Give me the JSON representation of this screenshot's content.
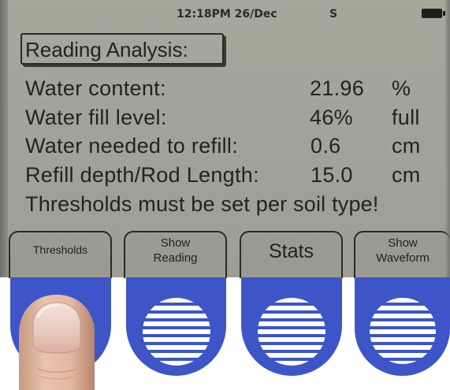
{
  "status_bar": {
    "clock": "12:18PM 26/Dec",
    "signal": "S"
  },
  "screen": {
    "title": "Reading Analysis:",
    "rows": [
      {
        "label": "Water content:",
        "value": "21.96",
        "unit": "%"
      },
      {
        "label": "Water fill level:",
        "value": "46%",
        "unit": "full"
      },
      {
        "label": "Water needed to refill:",
        "value": "0.6",
        "unit": "cm"
      },
      {
        "label": "Refill depth/Rod Length:",
        "value": "15.0",
        "unit": "cm"
      }
    ],
    "notice": "Thresholds must be set per soil type!"
  },
  "softkeys": {
    "thresholds": "Thresholds",
    "show_reading": [
      "Show",
      "Reading"
    ],
    "stats": "Stats",
    "show_waveform": [
      "Show",
      "Waveform"
    ]
  },
  "colors": {
    "lcd_background": "#a3a399",
    "lcd_text": "#23231f",
    "button_blue": "#3d55c7",
    "button_stripes": "#ffffff"
  },
  "icons": {
    "battery": "battery-icon",
    "button_graphic": "striped-circle-icon",
    "finger": "finger-pressing-icon"
  }
}
